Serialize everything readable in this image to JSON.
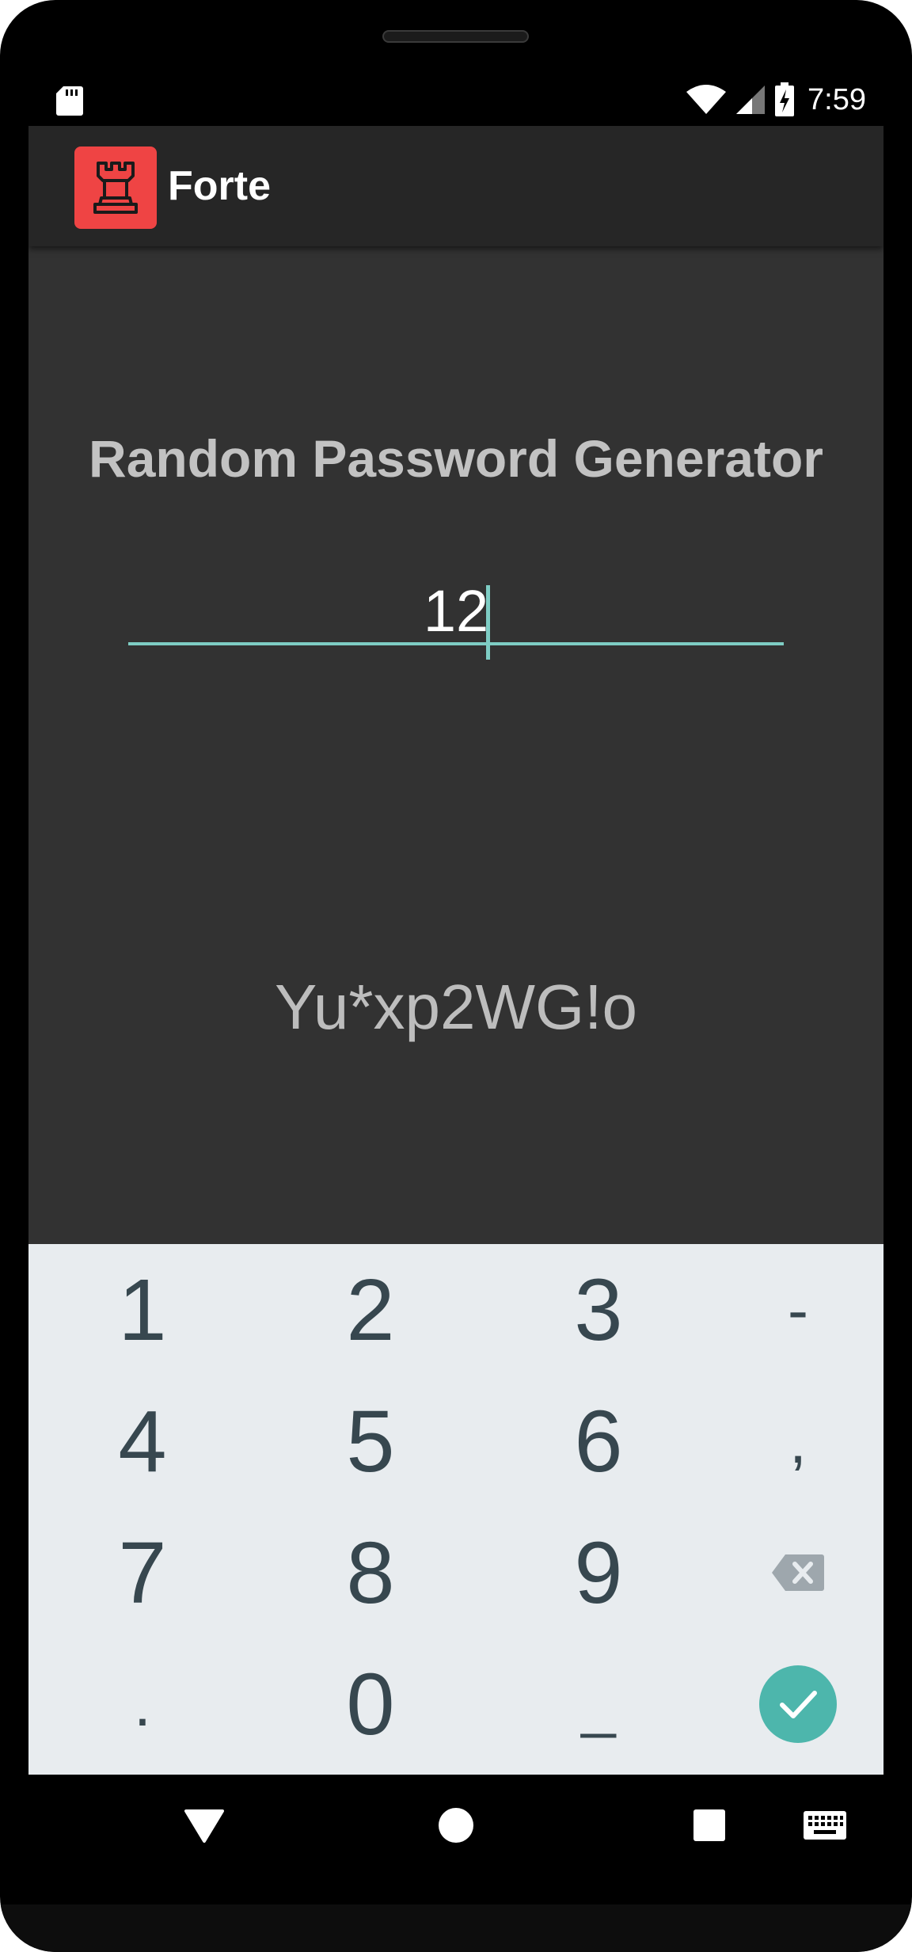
{
  "status_bar": {
    "time": "7:59",
    "icons": [
      "sd-card-icon",
      "wifi-icon",
      "cell-signal-icon",
      "battery-charging-icon"
    ]
  },
  "app_bar": {
    "title": "Forte",
    "logo_icon": "chess-rook-icon",
    "logo_color": "#ef4444"
  },
  "main": {
    "heading": "Random Password Generator",
    "length_input": {
      "value": "12",
      "placeholder": ""
    },
    "generated_password": "Yu*xp2WG!o"
  },
  "keypad": {
    "rows": [
      [
        "1",
        "2",
        "3",
        "-"
      ],
      [
        "4",
        "5",
        "6",
        ","
      ],
      [
        "7",
        "8",
        "9",
        "backspace"
      ],
      [
        ".",
        "0",
        "_",
        "done"
      ]
    ],
    "accent_color": "#4db6ac"
  },
  "nav_bar": {
    "buttons": [
      "back-icon",
      "home-icon",
      "recents-icon",
      "keyboard-icon"
    ]
  },
  "colors": {
    "background": "#323232",
    "app_bar": "#262626",
    "accent": "#7ecdc4",
    "keypad_bg": "#e8ecef",
    "key_text": "#37474f"
  }
}
